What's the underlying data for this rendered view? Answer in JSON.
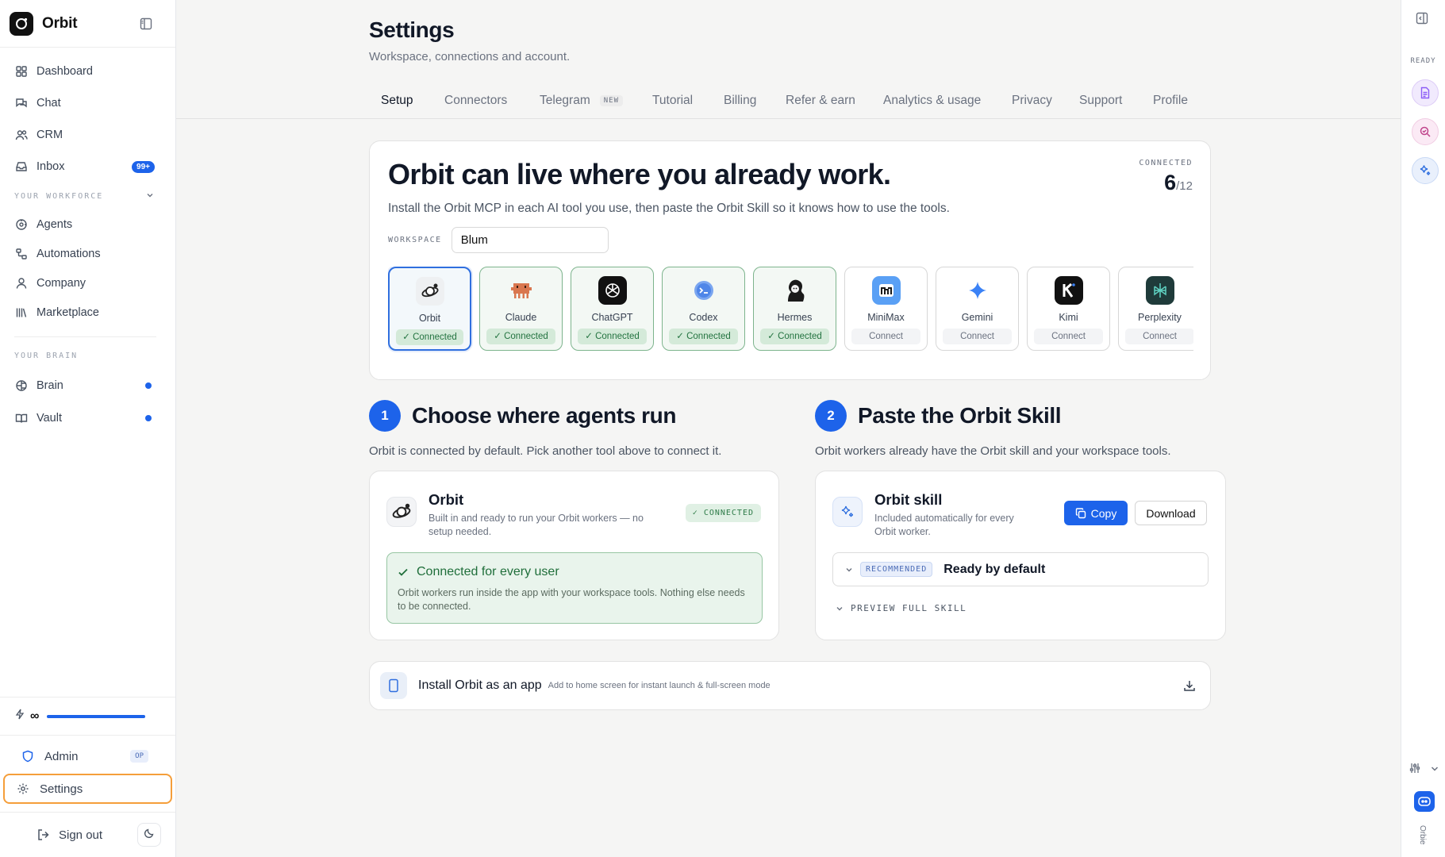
{
  "app": {
    "name": "Orbit"
  },
  "sidebar": {
    "items": [
      {
        "label": "Dashboard",
        "icon": "grid-icon"
      },
      {
        "label": "Chat",
        "icon": "chat-icon"
      },
      {
        "label": "CRM",
        "icon": "users-icon"
      },
      {
        "label": "Inbox",
        "icon": "inbox-icon",
        "badge": "99+"
      }
    ],
    "section_workforce": "YOUR WORKFORCE",
    "workforce_items": [
      {
        "label": "Agents",
        "icon": "agents-icon"
      },
      {
        "label": "Automations",
        "icon": "automations-icon"
      },
      {
        "label": "Company",
        "icon": "person-icon"
      },
      {
        "label": "Marketplace",
        "icon": "library-icon"
      }
    ],
    "section_brain": "YOUR BRAIN",
    "brain_items": [
      {
        "label": "Brain",
        "icon": "brain-icon"
      },
      {
        "label": "Vault",
        "icon": "book-icon"
      }
    ],
    "credits": {
      "symbol": "∞",
      "fraction": 1.0
    },
    "admin": {
      "label": "Admin",
      "badge": "OP"
    },
    "settings": {
      "label": "Settings"
    },
    "signout": {
      "label": "Sign out"
    }
  },
  "page": {
    "title": "Settings",
    "subtitle": "Workspace, connections and account."
  },
  "tabs": [
    {
      "label": "Setup",
      "active": true
    },
    {
      "label": "Connectors"
    },
    {
      "label": "Telegram",
      "badge": "NEW"
    },
    {
      "label": "Tutorial"
    },
    {
      "label": "Billing"
    },
    {
      "label": "Refer & earn"
    },
    {
      "label": "Analytics & usage"
    },
    {
      "label": "Privacy"
    },
    {
      "label": "Support"
    },
    {
      "label": "Profile"
    }
  ],
  "hero": {
    "title": "Orbit can live where you already work.",
    "subtitle": "Install the Orbit MCP in each AI tool you use, then paste the Orbit Skill so it knows how to use the tools.",
    "connected_label": "CONNECTED",
    "connected_value": "6",
    "connected_total": "/12",
    "workspace_label": "WORKSPACE",
    "workspace_value": "Blum"
  },
  "tools": [
    {
      "name": "Orbit",
      "status": "Connected"
    },
    {
      "name": "Claude",
      "status": "Connected"
    },
    {
      "name": "ChatGPT",
      "status": "Connected"
    },
    {
      "name": "Codex",
      "status": "Connected"
    },
    {
      "name": "Hermes",
      "status": "Connected"
    },
    {
      "name": "MiniMax",
      "status": "Connect"
    },
    {
      "name": "Gemini",
      "status": "Connect"
    },
    {
      "name": "Kimi",
      "status": "Connect"
    },
    {
      "name": "Perplexity",
      "status": "Connect"
    }
  ],
  "step1": {
    "number": "1",
    "title": "Choose where agents run",
    "desc": "Orbit is connected by default. Pick another tool above to connect it.",
    "card_title": "Orbit",
    "card_desc": "Built in and ready to run your Orbit workers — no setup needed.",
    "badge": "CONNECTED",
    "notice_title": "Connected for every user",
    "notice_desc": "Orbit workers run inside the app with your workspace tools. Nothing else needs to be connected."
  },
  "step2": {
    "number": "2",
    "title": "Paste the Orbit Skill",
    "desc": "Orbit workers already have the Orbit skill and your workspace tools.",
    "card_title": "Orbit skill",
    "card_desc": "Included automatically for every Orbit worker.",
    "copy_label": "Copy",
    "download_label": "Download",
    "rec_badge": "RECOMMENDED",
    "rec_title": "Ready by default",
    "preview_label": "PREVIEW FULL SKILL"
  },
  "install": {
    "title": "Install Orbit as an app",
    "subtitle": "Add to home screen for instant launch & full-screen mode"
  },
  "rail": {
    "ready_label": "READY",
    "vertical_label": "Orbie"
  },
  "colors": {
    "accent": "#1d63ea",
    "connected_green": "#237340",
    "settings_highlight": "#f59e3a"
  }
}
